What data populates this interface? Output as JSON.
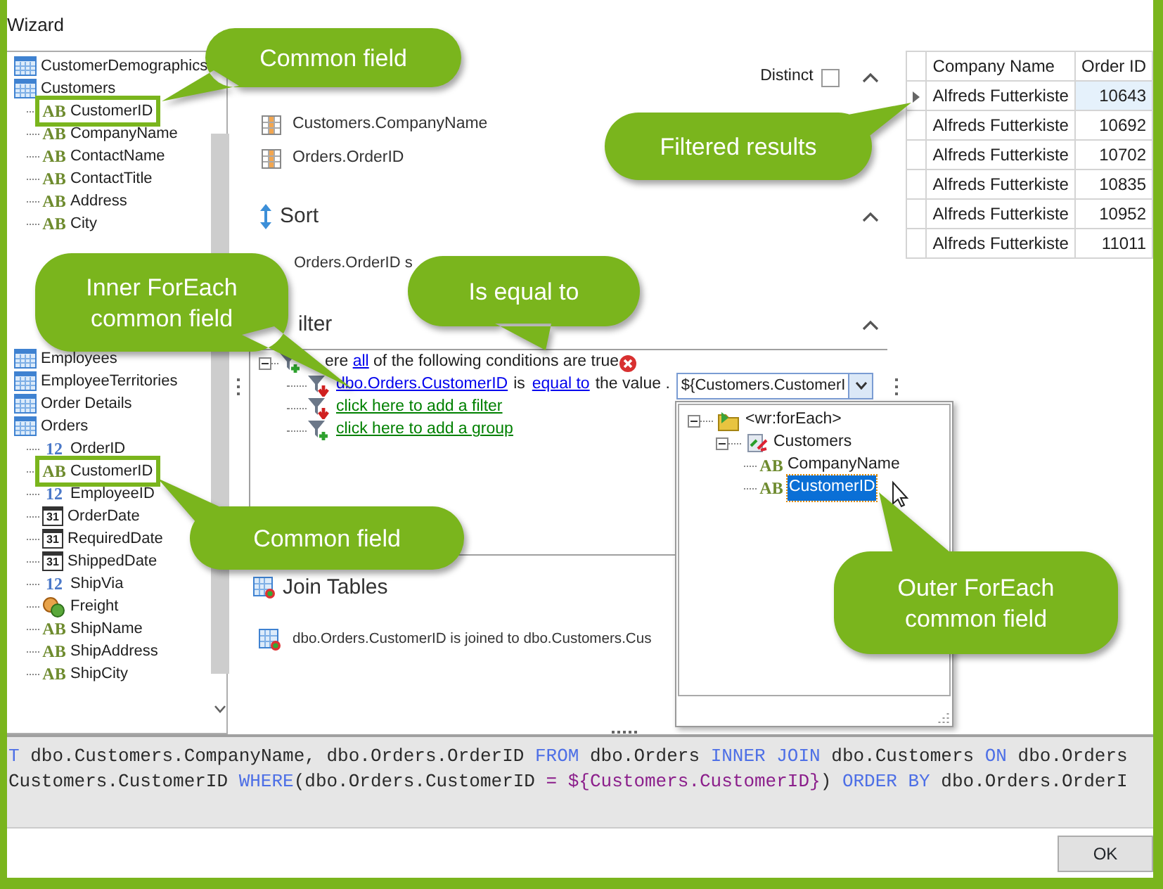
{
  "window": {
    "title": "Wizard"
  },
  "tree": {
    "items": [
      {
        "label": "CustomerDemographics",
        "kind": "table"
      },
      {
        "label": "Customers",
        "kind": "table",
        "children": [
          {
            "label": "CustomerID",
            "kind": "text",
            "type_mark": "AB",
            "marked": true
          },
          {
            "label": "CompanyName",
            "kind": "text",
            "type_mark": "AB"
          },
          {
            "label": "ContactName",
            "kind": "text",
            "type_mark": "AB"
          },
          {
            "label": "ContactTitle",
            "kind": "text",
            "type_mark": "AB"
          },
          {
            "label": "Address",
            "kind": "text",
            "type_mark": "AB"
          },
          {
            "label": "City",
            "kind": "text",
            "type_mark": "AB"
          }
        ]
      },
      {
        "label": "Employees",
        "kind": "table"
      },
      {
        "label": "EmployeeTerritories",
        "kind": "table"
      },
      {
        "label": "Order Details",
        "kind": "table"
      },
      {
        "label": "Orders",
        "kind": "table",
        "children": [
          {
            "label": "OrderID",
            "kind": "number",
            "type_mark": "12"
          },
          {
            "label": "CustomerID",
            "kind": "text",
            "type_mark": "AB",
            "marked": true
          },
          {
            "label": "EmployeeID",
            "kind": "number",
            "type_mark": "12"
          },
          {
            "label": "OrderDate",
            "kind": "date",
            "type_mark": "31"
          },
          {
            "label": "RequiredDate",
            "kind": "date",
            "type_mark": "31"
          },
          {
            "label": "ShippedDate",
            "kind": "date",
            "type_mark": "31"
          },
          {
            "label": "ShipVia",
            "kind": "number",
            "type_mark": "12"
          },
          {
            "label": "Freight",
            "kind": "money"
          },
          {
            "label": "ShipName",
            "kind": "text",
            "type_mark": "AB"
          },
          {
            "label": "ShipAddress",
            "kind": "text",
            "type_mark": "AB"
          },
          {
            "label": "ShipCity",
            "kind": "text",
            "type_mark": "AB"
          }
        ]
      }
    ]
  },
  "columns": {
    "distinct": {
      "label": "Distinct",
      "checked": false
    },
    "items": [
      "Customers.CompanyName",
      "Orders.OrderID"
    ]
  },
  "sort": {
    "title": "Sort",
    "items": [
      "Orders.OrderID s"
    ]
  },
  "filter": {
    "title": "ilter",
    "expanded": true,
    "header_parts": [
      {
        "text": "ere ",
        "kind": "text"
      },
      {
        "text": "all",
        "kind": "link"
      },
      {
        "text": " of the following conditions are true",
        "kind": "text"
      }
    ],
    "condition": {
      "field": "dbo.Orders.CustomerID",
      "is": "is",
      "operator": "equal to",
      "value_label": "the value .",
      "value": "${Customers.CustomerI"
    },
    "add_links": [
      "click here to add a filter",
      "click here to add a group"
    ]
  },
  "value_dropdown": {
    "items": [
      {
        "label": "<wr:forEach>",
        "kind": "foreach",
        "expanded": true,
        "children": [
          {
            "label": "Customers",
            "kind": "datasource",
            "expanded": true,
            "children": [
              {
                "label": "CompanyName",
                "kind": "text",
                "type_mark": "AB",
                "selected": false
              },
              {
                "label": "CustomerID",
                "kind": "text",
                "type_mark": "AB",
                "selected": true
              }
            ]
          }
        ]
      }
    ]
  },
  "join": {
    "title": "Join Tables",
    "items": [
      "dbo.Orders.CustomerID is joined to dbo.Customers.Cus"
    ]
  },
  "results": {
    "columns": [
      "Company Name",
      "Order ID"
    ],
    "rows": [
      {
        "cells": [
          "Alfreds Futterkiste",
          "10643"
        ],
        "selected": true
      },
      {
        "cells": [
          "Alfreds Futterkiste",
          "10692"
        ],
        "selected": false
      },
      {
        "cells": [
          "Alfreds Futterkiste",
          "10702"
        ],
        "selected": false
      },
      {
        "cells": [
          "Alfreds Futterkiste",
          "10835"
        ],
        "selected": false
      },
      {
        "cells": [
          "Alfreds Futterkiste",
          "10952"
        ],
        "selected": false
      },
      {
        "cells": [
          "Alfreds Futterkiste",
          "11011"
        ],
        "selected": false
      }
    ]
  },
  "sql": {
    "lines": [
      [
        {
          "text": "T",
          "kind": "keyword"
        },
        {
          "text": " dbo.Customers.CompanyName, dbo.Orders.OrderID ",
          "kind": "plain"
        },
        {
          "text": "FROM",
          "kind": "keyword"
        },
        {
          "text": " dbo.Orders ",
          "kind": "plain"
        },
        {
          "text": "INNER JOIN",
          "kind": "keyword"
        },
        {
          "text": " dbo.Customers ",
          "kind": "plain"
        },
        {
          "text": "ON",
          "kind": "keyword"
        },
        {
          "text": " dbo.Orders",
          "kind": "plain"
        }
      ],
      [
        {
          "text": "Customers.CustomerID ",
          "kind": "plain"
        },
        {
          "text": "WHERE",
          "kind": "keyword"
        },
        {
          "text": "(dbo.Orders.CustomerID ",
          "kind": "plain"
        },
        {
          "text": "= ${Customers.CustomerID}",
          "kind": "variable"
        },
        {
          "text": ") ",
          "kind": "plain"
        },
        {
          "text": "ORDER BY",
          "kind": "keyword"
        },
        {
          "text": " dbo.Orders.OrderI",
          "kind": "plain"
        }
      ]
    ]
  },
  "buttons": [
    "OK"
  ],
  "callouts": [
    {
      "lines": [
        "Common field"
      ]
    },
    {
      "lines": [
        "Filtered results"
      ]
    },
    {
      "lines": [
        "Inner ForEach",
        "common field"
      ]
    },
    {
      "lines": [
        "Is equal to"
      ]
    },
    {
      "lines": [
        "Common field"
      ]
    },
    {
      "lines": [
        "Outer ForEach",
        "common field"
      ]
    }
  ]
}
